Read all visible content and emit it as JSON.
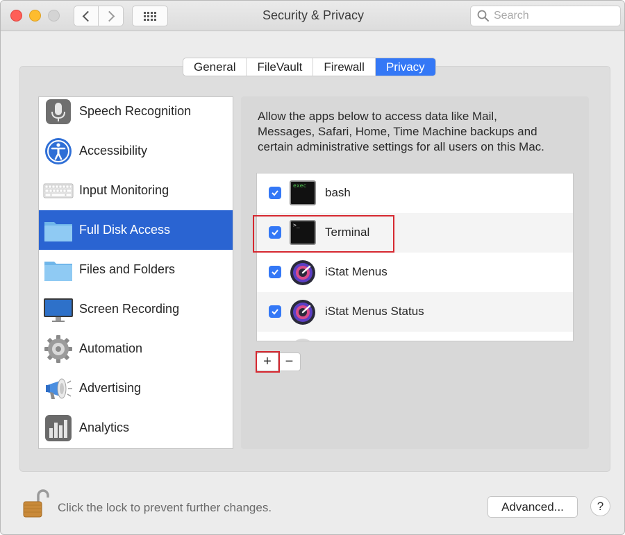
{
  "window": {
    "title": "Security & Privacy",
    "search_placeholder": "Search"
  },
  "tabs": [
    {
      "label": "General",
      "selected": false
    },
    {
      "label": "FileVault",
      "selected": false
    },
    {
      "label": "Firewall",
      "selected": false
    },
    {
      "label": "Privacy",
      "selected": true
    }
  ],
  "sidebar": {
    "items": [
      {
        "label": "Speech Recognition",
        "icon": "microphone-icon",
        "selected": false
      },
      {
        "label": "Accessibility",
        "icon": "accessibility-icon",
        "selected": false
      },
      {
        "label": "Input Monitoring",
        "icon": "keyboard-icon",
        "selected": false
      },
      {
        "label": "Full Disk Access",
        "icon": "folder-icon",
        "selected": true
      },
      {
        "label": "Files and Folders",
        "icon": "folder-icon",
        "selected": false
      },
      {
        "label": "Screen Recording",
        "icon": "monitor-icon",
        "selected": false
      },
      {
        "label": "Automation",
        "icon": "gear-icon",
        "selected": false
      },
      {
        "label": "Advertising",
        "icon": "megaphone-icon",
        "selected": false
      },
      {
        "label": "Analytics",
        "icon": "bar-chart-icon",
        "selected": false
      }
    ]
  },
  "content": {
    "description_lines": [
      "Allow the apps below to access data like Mail,",
      "Messages, Safari, Home, Time Machine backups and",
      "certain administrative settings for all users on this Mac."
    ],
    "apps": [
      {
        "name": "bash",
        "checked": true,
        "icon": "terminal-icon"
      },
      {
        "name": "Terminal",
        "checked": true,
        "icon": "terminal-icon"
      },
      {
        "name": "iStat Menus",
        "checked": true,
        "icon": "istat-icon"
      },
      {
        "name": "iStat Menus Status",
        "checked": true,
        "icon": "istat-icon"
      }
    ],
    "add_label": "+",
    "remove_label": "−"
  },
  "footer": {
    "lock_text": "Click the lock to prevent further changes.",
    "advanced_label": "Advanced...",
    "help_label": "?"
  },
  "colors": {
    "accent": "#3478f6",
    "selection": "#2a64d2",
    "highlight": "#d62830"
  }
}
